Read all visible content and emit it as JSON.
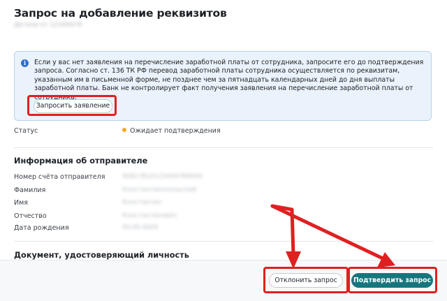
{
  "header": {
    "title": "Запрос на добавление реквизитов",
    "subtitle": "Детали от 12345678"
  },
  "notice": {
    "icon": "info-icon",
    "text": "Если у вас нет заявления на перечисление заработной платы от сотрудника, запросите его до подтверждения запроса. Согласно ст. 136 ТК РФ перевод заработной платы сотрудника осуществляется по реквизитам, указанным им в письменной форме, не позднее чем за пятнадцать календарных дней до дня выплаты заработной платы. Банк не контролирует факт получения заявления на перечисление заработной платы от сотрудника.",
    "button_label": "Запросить заявление"
  },
  "status": {
    "label": "Статус",
    "value": "Ожидает подтверждения",
    "dot_color": "#f5a623"
  },
  "sender": {
    "title": "Информация об отправителе",
    "fields": [
      {
        "label": "Номер счёта отправителя",
        "value": "40817810123456789000"
      },
      {
        "label": "Фамилия",
        "value": "Константинопольский"
      },
      {
        "label": "Имя",
        "value": "Константин"
      },
      {
        "label": "Отчество",
        "value": "Константинович"
      },
      {
        "label": "Дата рождения",
        "value": "00.00.0000"
      }
    ]
  },
  "document": {
    "title": "Документ, удостоверяющий личность"
  },
  "footer": {
    "reject_label": "Отклонить запрос",
    "confirm_label": "Подтвердить запрос",
    "confirm_color": "#17767d"
  },
  "annotations": {
    "highlight_color": "#e02020"
  }
}
